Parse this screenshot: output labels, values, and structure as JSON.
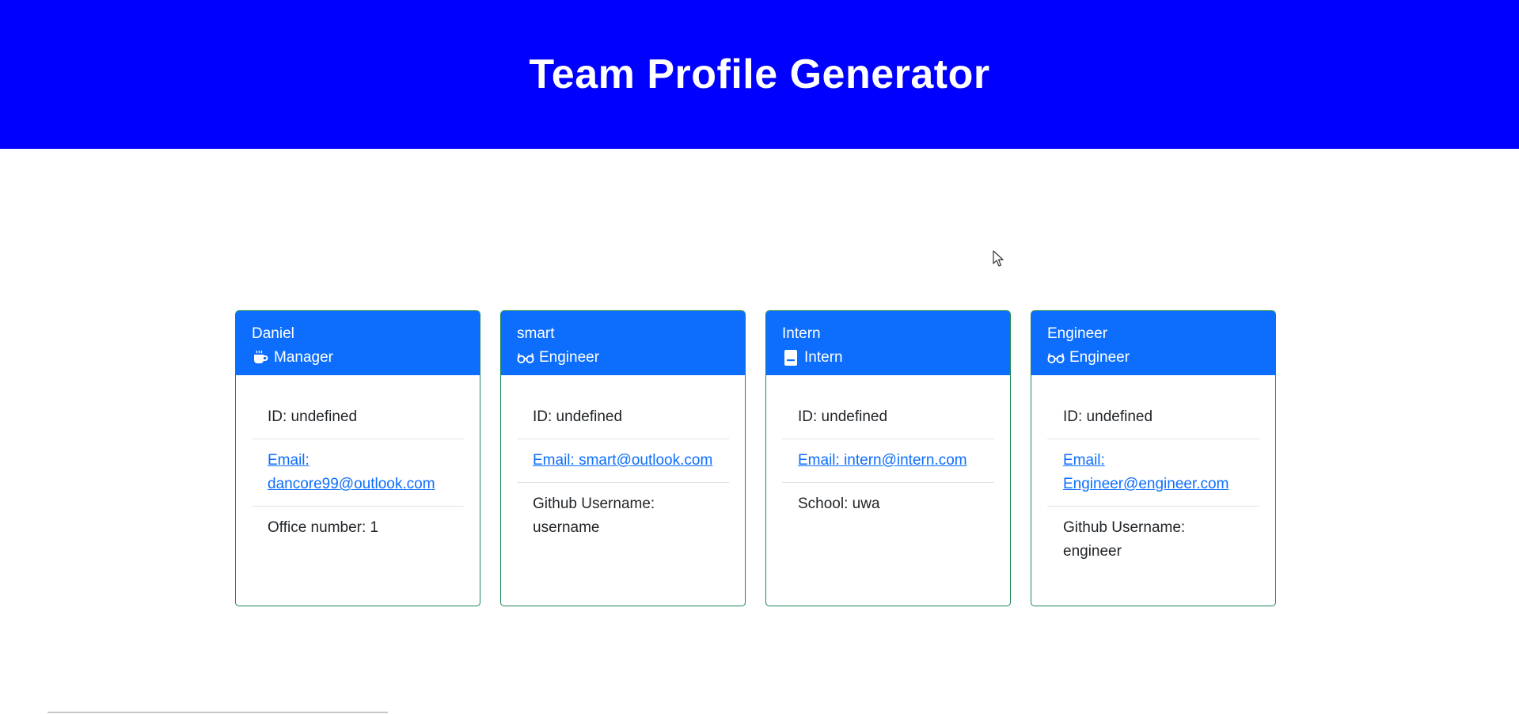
{
  "header": {
    "title": "Team Profile Generator"
  },
  "cards": [
    {
      "name": "Daniel",
      "role": "Manager",
      "role_icon": "mug-icon",
      "id_text": "ID: undefined",
      "email_text": "Email: dancore99@outlook.com",
      "extra_text": "Office number: 1"
    },
    {
      "name": "smart",
      "role": "Engineer",
      "role_icon": "glasses-icon",
      "id_text": "ID: undefined",
      "email_text": "Email: smart@outlook.com",
      "extra_text": "Github Username: username"
    },
    {
      "name": "Intern",
      "role": "Intern",
      "role_icon": "id-badge-icon",
      "id_text": "ID: undefined",
      "email_text": "Email: intern@intern.com",
      "extra_text": "School: uwa"
    },
    {
      "name": "Engineer",
      "role": "Engineer",
      "role_icon": "glasses-icon",
      "id_text": "ID: undefined",
      "email_text": "Email: Engineer@engineer.com",
      "extra_text": "Github Username: engineer"
    }
  ],
  "colors": {
    "header_bg": "#0000ff",
    "card_header_bg": "#0d6efd",
    "card_border": "#198754",
    "link": "#0d6efd"
  }
}
